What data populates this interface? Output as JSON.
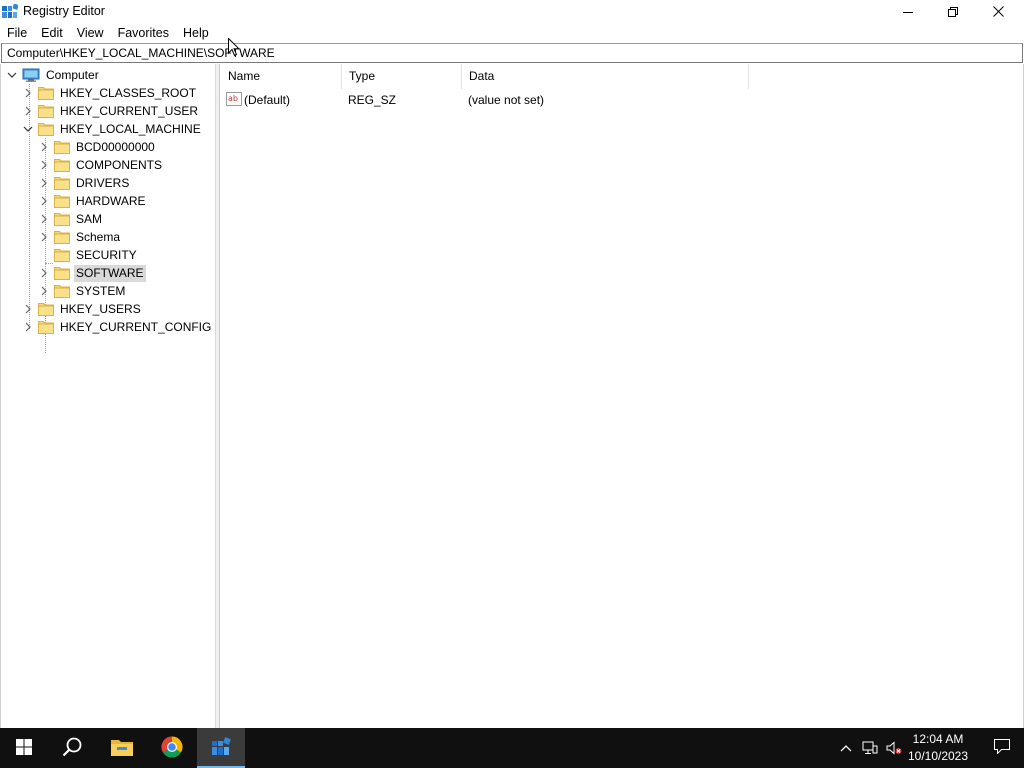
{
  "window": {
    "title": "Registry Editor",
    "icon": "regedit-icon",
    "controls": {
      "minimize": "minimize-icon",
      "restore": "restore-icon",
      "close": "close-icon"
    }
  },
  "menu": [
    "File",
    "Edit",
    "View",
    "Favorites",
    "Help"
  ],
  "address": "Computer\\HKEY_LOCAL_MACHINE\\SOFTWARE",
  "tree": {
    "root": "Computer",
    "hives": [
      {
        "label": "HKEY_CLASSES_ROOT",
        "expanded": false
      },
      {
        "label": "HKEY_CURRENT_USER",
        "expanded": false
      },
      {
        "label": "HKEY_LOCAL_MACHINE",
        "expanded": true
      },
      {
        "label": "HKEY_USERS",
        "expanded": false
      },
      {
        "label": "HKEY_CURRENT_CONFIG",
        "expanded": false
      }
    ],
    "hklm_children": [
      {
        "label": "BCD00000000",
        "has_children": true
      },
      {
        "label": "COMPONENTS",
        "has_children": true
      },
      {
        "label": "DRIVERS",
        "has_children": true
      },
      {
        "label": "HARDWARE",
        "has_children": true
      },
      {
        "label": "SAM",
        "has_children": true
      },
      {
        "label": "Schema",
        "has_children": true
      },
      {
        "label": "SECURITY",
        "has_children": false
      },
      {
        "label": "SOFTWARE",
        "has_children": true,
        "selected": true
      },
      {
        "label": "SYSTEM",
        "has_children": true
      }
    ]
  },
  "list": {
    "columns": [
      "Name",
      "Type",
      "Data"
    ],
    "rows": [
      {
        "icon": "string-value-icon",
        "name": "(Default)",
        "type": "REG_SZ",
        "data": "(value not set)"
      }
    ]
  },
  "taskbar": {
    "apps": [
      "start-icon",
      "search-icon",
      "file-explorer-icon",
      "chrome-icon",
      "regedit-icon"
    ],
    "active_app": "regedit-icon",
    "time": "12:04 AM",
    "date": "10/10/2023",
    "accent": "#76b9ed"
  }
}
